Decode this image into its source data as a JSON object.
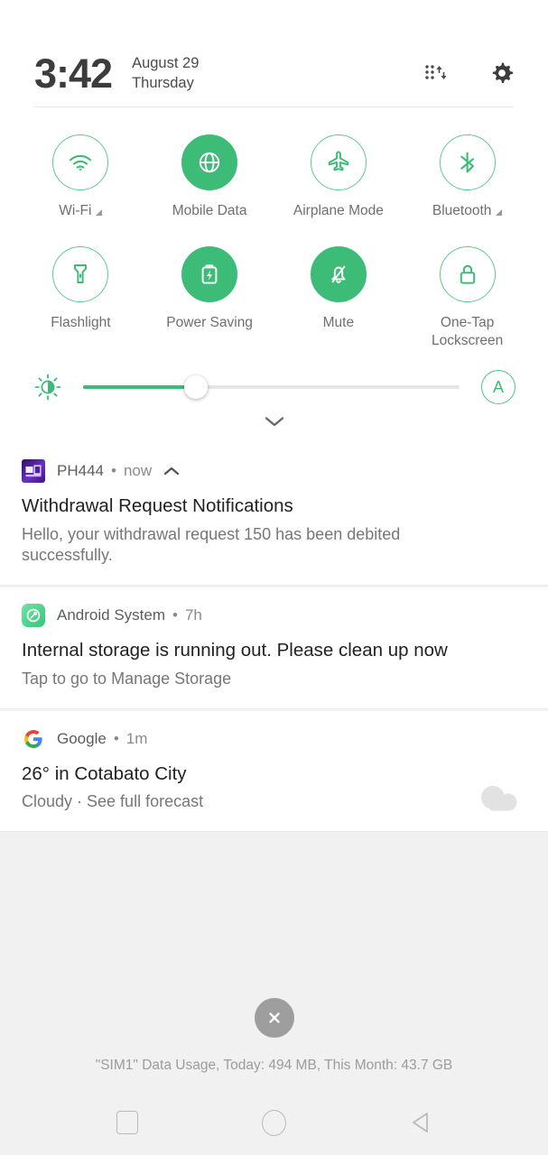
{
  "status_bar": {
    "time": "3:42",
    "date": "August 29",
    "weekday": "Thursday",
    "icons": {
      "data_usage": "data-usage-icon",
      "settings": "gear-icon"
    }
  },
  "quick_settings": {
    "accent_on": "#3cbc77",
    "accent_outline": "#5ec98e",
    "tiles": [
      {
        "label": "Wi-Fi",
        "icon": "wifi-icon",
        "state": "off",
        "has_expand": true
      },
      {
        "label": "Mobile Data",
        "icon": "globe-icon",
        "state": "on",
        "has_expand": false
      },
      {
        "label": "Airplane Mode",
        "icon": "airplane-icon",
        "state": "off",
        "has_expand": false
      },
      {
        "label": "Bluetooth",
        "icon": "bluetooth-icon",
        "state": "off",
        "has_expand": true
      },
      {
        "label": "Flashlight",
        "icon": "flashlight-icon",
        "state": "off",
        "has_expand": false
      },
      {
        "label": "Power Saving",
        "icon": "battery-bolt-icon",
        "state": "on",
        "has_expand": false
      },
      {
        "label": "Mute",
        "icon": "bell-slash-icon",
        "state": "on",
        "has_expand": false
      },
      {
        "label": "One-Tap\nLockscreen",
        "label_line1": "One-Tap",
        "label_line2": "Lockscreen",
        "icon": "lock-icon",
        "state": "off",
        "has_expand": false
      }
    ],
    "brightness": {
      "icon": "brightness-icon",
      "value_percent": 30,
      "auto_label": "A"
    },
    "expand_handle": "chevron-down-icon"
  },
  "notifications": [
    {
      "app": "PH444",
      "app_icon": "ph444-app-icon",
      "time": "now",
      "separator": "•",
      "expand_state": "chevron-up-icon",
      "title": "Withdrawal Request Notifications",
      "body": "Hello, your withdrawal request 150 has been debited successfully."
    },
    {
      "app": "Android System",
      "app_icon": "android-system-icon",
      "time": "7h",
      "separator": "•",
      "title": "Internal storage is running out. Please clean up now",
      "body": "Tap to go to Manage Storage"
    },
    {
      "app": "Google",
      "app_icon": "google-icon",
      "time": "1m",
      "separator": "•",
      "title": "26° in Cotabato City",
      "body": "Cloudy · See full forecast",
      "thumbnail": "cloud-icon"
    }
  ],
  "footer": {
    "clear_all": "close-icon",
    "data_usage": "\"SIM1\" Data Usage, Today: 494 MB, This Month: 43.7 GB"
  },
  "navbar": {
    "recents": "square-icon",
    "home": "circle-icon",
    "back": "triangle-left-icon"
  }
}
